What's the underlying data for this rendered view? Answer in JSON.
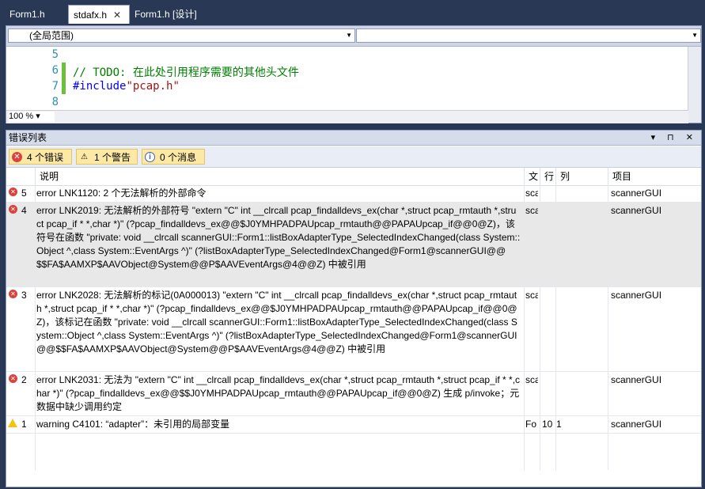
{
  "tabs": [
    {
      "label": "Form1.h"
    },
    {
      "label": "stdafx.h",
      "close": "✕"
    },
    {
      "label": "Form1.h [设计]"
    }
  ],
  "editor": {
    "scope_combo": "(全局范围)",
    "member_combo": "",
    "line_numbers": [
      "5",
      "6",
      "7",
      "8"
    ],
    "line6": "// TODO: 在此处引用程序需要的其他头文件",
    "line7_kw": "#include",
    "line7_str": "\"pcap.h\"",
    "zoom": "100 %"
  },
  "error_list": {
    "title": "错误列表",
    "title_buttons": "▾ ⊓ ✕",
    "filters": {
      "errors": "4 个错误",
      "warnings": "1 个警告",
      "messages": "0 个消息"
    },
    "columns": {
      "description": "说明",
      "file": "文",
      "line": "行",
      "column": "列",
      "project": "项目"
    },
    "rows": [
      {
        "type": "error",
        "num": "5",
        "desc": "error LNK1120: 2 个无法解析的外部命令",
        "file": "sca",
        "line": "",
        "col": "",
        "project": "scannerGUI"
      },
      {
        "type": "error",
        "num": "4",
        "desc": "error LNK2019: 无法解析的外部符号 \"extern \"C\" int __clrcall pcap_findalldevs_ex(char *,struct pcap_rmtauth *,struct pcap_if * *,char *)\" (?pcap_findalldevs_ex@@$J0YMHPADPAUpcap_rmtauth@@PAPAUpcap_if@@0@Z)，该符号在函数 \"private: void __clrcall scannerGUI::Form1::listBoxAdapterType_SelectedIndexChanged(class System::Object ^,class System::EventArgs ^)\" (?listBoxAdapterType_SelectedIndexChanged@Form1@scannerGUI@@$$FA$AAMXP$AAVObject@System@@P$AAVEventArgs@4@@Z) 中被引用",
        "file": "sca",
        "line": "",
        "col": "",
        "project": "scannerGUI"
      },
      {
        "type": "error",
        "num": "3",
        "desc": "error LNK2028: 无法解析的标记(0A000013) \"extern \"C\" int __clrcall pcap_findalldevs_ex(char *,struct pcap_rmtauth *,struct pcap_if * *,char *)\" (?pcap_findalldevs_ex@@$J0YMHPADPAUpcap_rmtauth@@PAPAUpcap_if@@0@Z)，该标记在函数 \"private: void __clrcall scannerGUI::Form1::listBoxAdapterType_SelectedIndexChanged(class System::Object ^,class System::EventArgs ^)\" (?listBoxAdapterType_SelectedIndexChanged@Form1@scannerGUI@@$$FA$AAMXP$AAVObject@System@@P$AAVEventArgs@4@@Z) 中被引用",
        "file": "sca",
        "line": "",
        "col": "",
        "project": "scannerGUI"
      },
      {
        "type": "error",
        "num": "2",
        "desc": "error LNK2031: 无法为 \"extern \"C\" int __clrcall pcap_findalldevs_ex(char *,struct pcap_rmtauth *,struct pcap_if * *,char *)\" (?pcap_findalldevs_ex@@$$J0YMHPADPAUpcap_rmtauth@@PAPAUpcap_if@@0@Z) 生成 p/invoke；元数据中缺少调用约定",
        "file": "sca",
        "line": "",
        "col": "",
        "project": "scannerGUI"
      },
      {
        "type": "warning",
        "num": "1",
        "desc": "warning C4101: “adapter”：未引用的局部变量",
        "file": "Fo",
        "line": "10",
        "col": "1",
        "project": "scannerGUI"
      }
    ]
  }
}
